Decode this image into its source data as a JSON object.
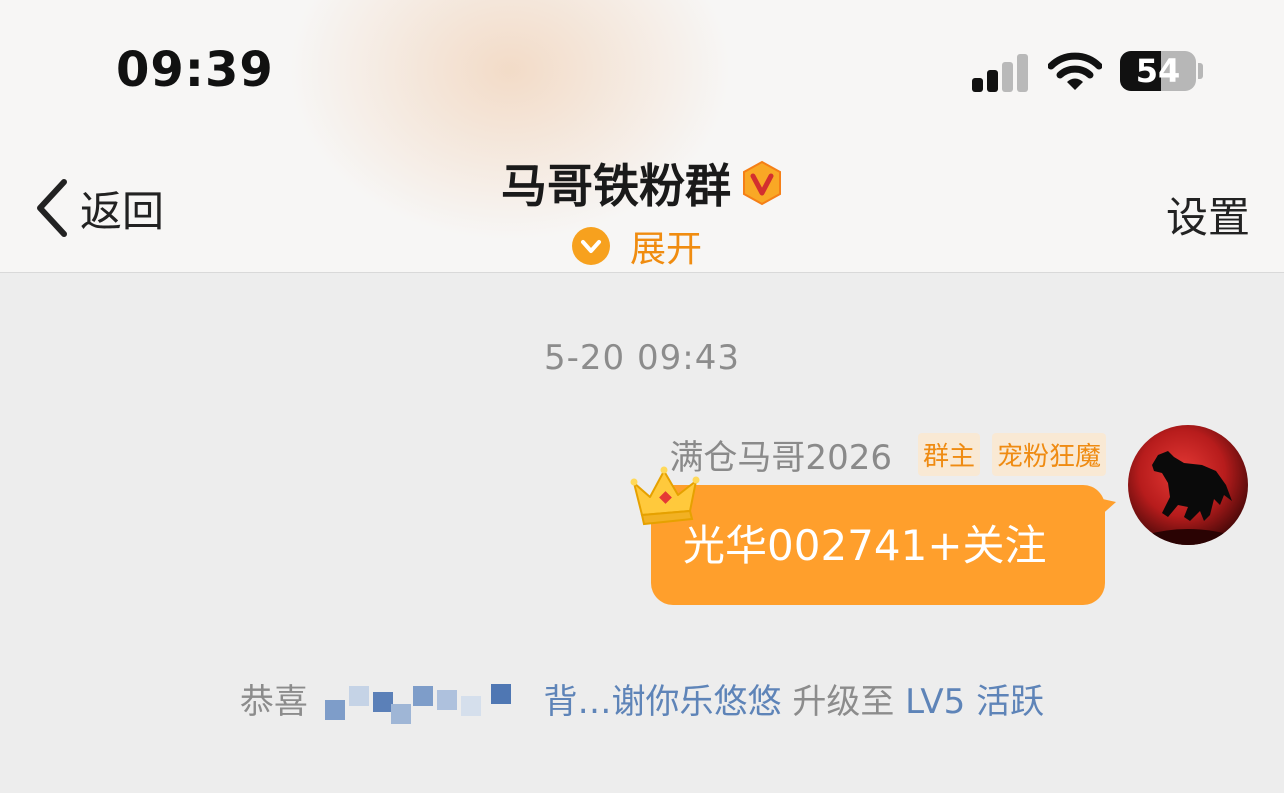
{
  "status_bar": {
    "time": "09:39",
    "battery": "54",
    "battery_level_percent": 54
  },
  "nav": {
    "back_label": "返回",
    "title": "马哥铁粉群",
    "expand_label": "展开",
    "settings_label": "设置"
  },
  "chat": {
    "timestamp": "5-20 09:43",
    "message": {
      "sender": "满仓马哥2026",
      "tags": [
        "群主",
        "宠粉狂魔"
      ],
      "text": "光华002741+关注"
    },
    "system": {
      "prefix": "恭喜",
      "user": "背…谢你乐悠悠",
      "middle": "升级至",
      "level": "LV5 活跃"
    }
  },
  "colors": {
    "accent": "#ff9f2c",
    "link": "#5e84b8",
    "background": "#ededed"
  }
}
